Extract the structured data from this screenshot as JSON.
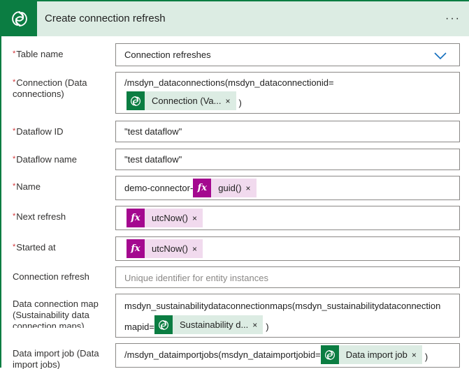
{
  "header": {
    "title": "Create connection refresh",
    "more_label": "···",
    "icon": "dataverse-icon",
    "accent_color": "#0b7d42",
    "header_bg": "#dcece3"
  },
  "fields": {
    "table_name": {
      "label": "Table name",
      "required": "*",
      "value": "Connection refreshes",
      "icon": "chevron-down-icon"
    },
    "connection": {
      "label": "Connection (Data connections)",
      "required": "*",
      "prefix": "/msdyn_dataconnections(msdyn_dataconnectionid=",
      "token_label": "Connection (Va...",
      "token_remove": "×",
      "suffix": ")"
    },
    "dataflow_id": {
      "label": "Dataflow ID",
      "required": "*",
      "value": "\"test dataflow\""
    },
    "dataflow_name": {
      "label": "Dataflow name",
      "required": "*",
      "value": "\"test dataflow\""
    },
    "name": {
      "label": "Name",
      "required": "*",
      "prefix": "demo-connector-",
      "token_icon_text": "fx",
      "token_label": "guid()",
      "token_remove": "×"
    },
    "next_refresh": {
      "label": "Next refresh",
      "required": "*",
      "token_icon_text": "fx",
      "token_label": "utcNow()",
      "token_remove": "×"
    },
    "started_at": {
      "label": "Started at",
      "required": "*",
      "token_icon_text": "fx",
      "token_label": "utcNow()",
      "token_remove": "×"
    },
    "connection_refresh": {
      "label": "Connection refresh",
      "placeholder": "Unique identifier for entity instances"
    },
    "data_connection_map": {
      "label": "Data connection map (Sustainability data connection maps)",
      "line1": "msdyn_sustainabilitydataconnectionmaps(msdyn_sustainabilitydataconnection",
      "line2_prefix": "mapid=",
      "token_label": "Sustainability d...",
      "token_remove": "×",
      "suffix": ")"
    },
    "data_import_job": {
      "label": "Data import job (Data import jobs)",
      "prefix": "/msdyn_dataimportjobs(msdyn_dataimportjobid=",
      "token_label": "Data import job",
      "token_remove": "×",
      "suffix": ")"
    }
  }
}
